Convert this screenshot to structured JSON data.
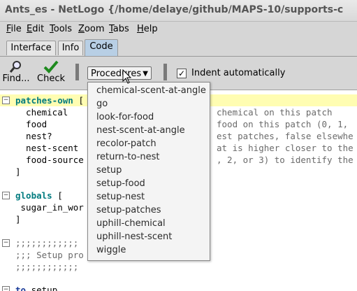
{
  "window": {
    "title": "Ants_es - NetLogo {/home/delaye/github/MAPS-10/supports-c"
  },
  "menu": [
    {
      "key": "F",
      "rest": "ile"
    },
    {
      "key": "E",
      "rest": "dit"
    },
    {
      "key": "T",
      "rest": "ools"
    },
    {
      "key": "Z",
      "rest": "oom"
    },
    {
      "key": "T",
      "rest": "abs"
    },
    {
      "key": "H",
      "rest": "elp"
    }
  ],
  "tabs": [
    "Interface",
    "Info",
    "Code"
  ],
  "toolbar": {
    "find_label": "Find...",
    "check_label": "Check",
    "procedures_label": "Procedures",
    "indent_label": "Indent automatically",
    "indent_checked": "✓"
  },
  "procedures": [
    "chemical-scent-at-angle",
    "go",
    "look-for-food",
    "nest-scent-at-angle",
    "recolor-patch",
    "return-to-nest",
    "setup",
    "setup-food",
    "setup-nest",
    "setup-patches",
    "uphill-chemical",
    "uphill-nest-scent",
    "wiggle"
  ],
  "code": {
    "l1_kw": "patches-own",
    "l1_rest": " [",
    "l2": "  chemical",
    "l2_right": "chemical on this patch",
    "l3": "  food",
    "l3_right": "food on this patch (0, 1,",
    "l4": "  nest?",
    "l4_right": "est patches, false elsewhe",
    "l5": "  nest-scent",
    "l5_right": "at is higher closer to the",
    "l6": "  food-source",
    "l6_right": ", 2, or 3) to identify the",
    "l7": "]",
    "l9_kw": "globals",
    "l9_rest": " [",
    "l10": " sugar_in_wor",
    "l11": "]",
    "l13": ";;;;;;;;;;;;",
    "l14": ";;; Setup pro",
    "l15": ";;;;;;;;;;;;",
    "l17_kw": "to",
    "l17_rest": " setup"
  }
}
